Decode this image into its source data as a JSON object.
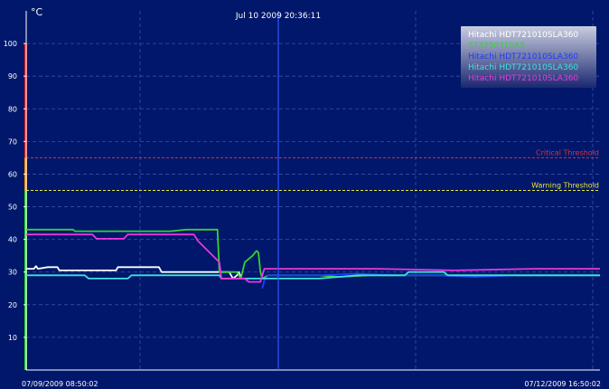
{
  "chart_data": {
    "type": "line",
    "unit_label": "°C",
    "cursor_time": "Jul 10 2009 20:36:11",
    "x_start_label": "07/09/2009 08:50:02",
    "x_end_label": "07/12/2009 16:50:02",
    "x_range_hours": [
      0,
      80
    ],
    "cursor_hours": 59.77,
    "ylim": [
      0,
      110
    ],
    "y_ticks": [
      10,
      20,
      30,
      40,
      50,
      60,
      70,
      80,
      90,
      100
    ],
    "grid": true,
    "legend_position": "top-right",
    "thresholds": [
      {
        "label": "Critical Threshold",
        "value": 65,
        "color": "#e0303a"
      },
      {
        "label": "Warning Threshold",
        "value": 55,
        "color": "#e8e83a"
      }
    ],
    "series": [
      {
        "name": "Hitachi HDT721010SLA360",
        "color": "#ffffff",
        "points": [
          [
            0,
            31
          ],
          [
            2,
            31
          ],
          [
            2.5,
            31.8
          ],
          [
            3,
            31
          ],
          [
            5.5,
            31.5
          ],
          [
            8,
            31.5
          ],
          [
            8.5,
            30.5
          ],
          [
            23,
            30.5
          ],
          [
            23.5,
            31.5
          ],
          [
            28,
            31.5
          ],
          [
            34,
            31.5
          ],
          [
            34.7,
            30
          ],
          [
            43,
            30
          ],
          [
            52,
            30
          ],
          [
            53,
            28
          ],
          [
            54,
            29
          ],
          [
            54.5,
            30
          ],
          [
            55,
            28.5
          ]
        ]
      },
      {
        "name": "ST3250310AS",
        "color": "#35d335",
        "points": [
          [
            0,
            43
          ],
          [
            12,
            43
          ],
          [
            12.5,
            42.5
          ],
          [
            37,
            42.5
          ],
          [
            41,
            43
          ],
          [
            49,
            43
          ],
          [
            49.5,
            30
          ],
          [
            54,
            30
          ],
          [
            55,
            28
          ],
          [
            56,
            33
          ],
          [
            58,
            35
          ],
          [
            59,
            36.5
          ],
          [
            59.5,
            36
          ],
          [
            60,
            30
          ],
          [
            60.5,
            28
          ],
          [
            62,
            29
          ],
          [
            75,
            29
          ],
          [
            80,
            28.5
          ],
          [
            88,
            29
          ],
          [
            98,
            29
          ],
          [
            107,
            29
          ],
          [
            115,
            29
          ],
          [
            130,
            29
          ],
          [
            147,
            29
          ]
        ]
      },
      {
        "name": "Hitachi HDT721010SLA360",
        "color": "#1f3cff",
        "points": [
          [
            60.5,
            25
          ],
          [
            61,
            27.5
          ],
          [
            62,
            29
          ],
          [
            75,
            29
          ],
          [
            85,
            29.5
          ],
          [
            95,
            29
          ],
          [
            105,
            29
          ],
          [
            115,
            28.5
          ],
          [
            125,
            29
          ],
          [
            135,
            29
          ],
          [
            147,
            29
          ]
        ]
      },
      {
        "name": "Hitachi HDT721010SLA360",
        "color": "#3ee0e0",
        "points": [
          [
            0,
            29
          ],
          [
            15,
            29
          ],
          [
            16,
            28
          ],
          [
            26,
            28
          ],
          [
            27,
            29
          ],
          [
            49,
            29
          ],
          [
            49.5,
            29
          ],
          [
            50,
            28
          ],
          [
            62,
            28
          ],
          [
            75,
            28
          ],
          [
            85,
            29
          ],
          [
            97,
            29
          ],
          [
            98,
            30
          ],
          [
            107,
            30
          ],
          [
            108,
            29
          ],
          [
            147,
            29
          ]
        ]
      },
      {
        "name": "Hitachi HDT721010SLA360",
        "color": "#e838e0",
        "points": [
          [
            0,
            41.5
          ],
          [
            17,
            41.5
          ],
          [
            18,
            40.2
          ],
          [
            25,
            40.2
          ],
          [
            26,
            41.5
          ],
          [
            43,
            41.5
          ],
          [
            44,
            39.5
          ],
          [
            49.5,
            33
          ],
          [
            50,
            28
          ],
          [
            56,
            28
          ],
          [
            57,
            27
          ],
          [
            60,
            27
          ],
          [
            61,
            31
          ],
          [
            70,
            31
          ],
          [
            90,
            31
          ],
          [
            110,
            30.5
          ],
          [
            130,
            31
          ],
          [
            147,
            31
          ]
        ]
      }
    ]
  }
}
